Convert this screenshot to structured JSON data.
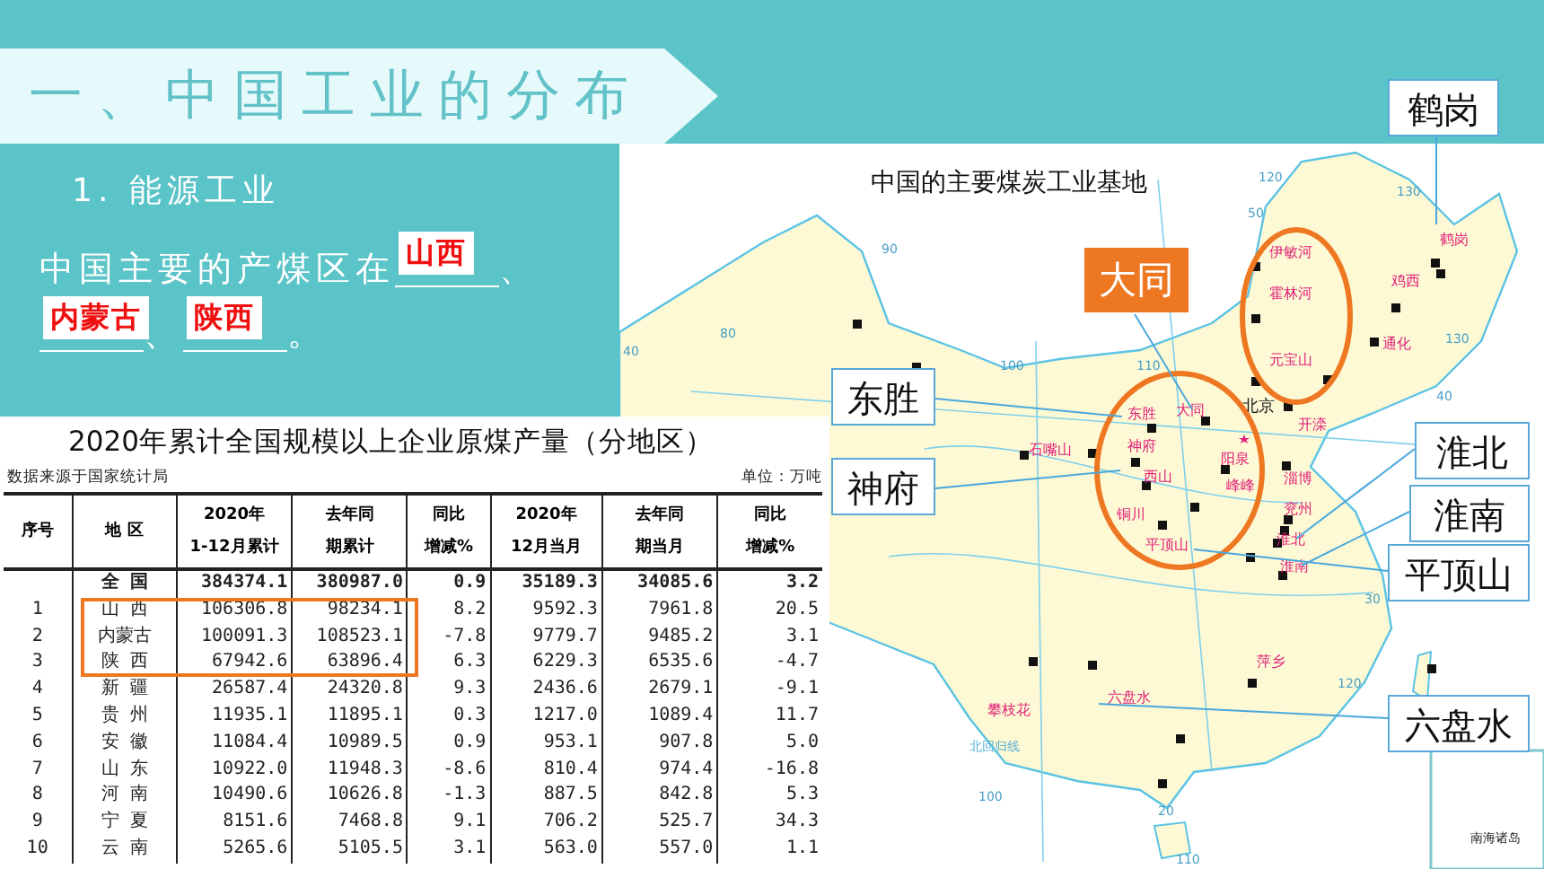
{
  "banner": {
    "title": "一、中国工业的分布"
  },
  "section": {
    "heading": "1. 能源工业",
    "sentence": [
      {
        "kind": "text",
        "text": "中国主要的产煤区在"
      },
      {
        "kind": "blank",
        "answer": "山西"
      },
      {
        "kind": "text",
        "text": "、"
      },
      {
        "kind": "blank",
        "answer": "内蒙古"
      },
      {
        "kind": "text",
        "text": "、"
      },
      {
        "kind": "blank",
        "answer": "陕西"
      },
      {
        "kind": "text",
        "text": "。"
      }
    ]
  },
  "table": {
    "title": "2020年累计全国规模以上企业原煤产量（分地区）",
    "source": "数据来源于国家统计局",
    "unit": "单位：万吨",
    "columns": [
      [
        "序号"
      ],
      [
        "地 区"
      ],
      [
        "2020年",
        "1-12月累计"
      ],
      [
        "去年同",
        "期累计"
      ],
      [
        "同比",
        "增减%"
      ],
      [
        "2020年",
        "12月当月"
      ],
      [
        "去年同",
        "期当月"
      ],
      [
        "同比",
        "增减%"
      ]
    ],
    "rows": [
      {
        "kind": "total",
        "region": "全 国",
        "values": [
          "384374.1",
          "380987.0",
          "0.9",
          "35189.3",
          "34085.6",
          "3.2"
        ],
        "highlighted": false
      },
      {
        "kind": "region",
        "no": "1",
        "region": "山 西",
        "values": [
          "106306.8",
          "98234.1",
          "8.2",
          "9592.3",
          "7961.8",
          "20.5"
        ],
        "highlighted": true
      },
      {
        "kind": "region",
        "no": "2",
        "region": "内蒙古",
        "values": [
          "100091.3",
          "108523.1",
          "-7.8",
          "9779.7",
          "9485.2",
          "3.1"
        ],
        "highlighted": true
      },
      {
        "kind": "region",
        "no": "3",
        "region": "陕 西",
        "values": [
          "67942.6",
          "63896.4",
          "6.3",
          "6229.3",
          "6535.6",
          "-4.7"
        ],
        "highlighted": true
      },
      {
        "kind": "region",
        "no": "4",
        "region": "新 疆",
        "values": [
          "26587.4",
          "24320.8",
          "9.3",
          "2436.6",
          "2679.1",
          "-9.1"
        ],
        "highlighted": false
      },
      {
        "kind": "region",
        "no": "5",
        "region": "贵 州",
        "values": [
          "11935.1",
          "11895.1",
          "0.3",
          "1217.0",
          "1089.4",
          "11.7"
        ],
        "highlighted": false
      },
      {
        "kind": "region",
        "no": "6",
        "region": "安 徽",
        "values": [
          "11084.4",
          "10989.5",
          "0.9",
          "953.1",
          "907.8",
          "5.0"
        ],
        "highlighted": false
      },
      {
        "kind": "region",
        "no": "7",
        "region": "山 东",
        "values": [
          "10922.0",
          "11948.3",
          "-8.6",
          "810.4",
          "974.4",
          "-16.8"
        ],
        "highlighted": false
      },
      {
        "kind": "region",
        "no": "8",
        "region": "河 南",
        "values": [
          "10490.6",
          "10626.8",
          "-1.3",
          "887.5",
          "842.8",
          "5.3"
        ],
        "highlighted": false
      },
      {
        "kind": "region",
        "no": "9",
        "region": "宁 夏",
        "values": [
          "8151.6",
          "7468.8",
          "9.1",
          "706.2",
          "525.7",
          "34.3"
        ],
        "highlighted": false
      },
      {
        "kind": "region",
        "no": "10",
        "region": "云 南",
        "values": [
          "5265.6",
          "5105.5",
          "3.1",
          "563.0",
          "557.0",
          "1.1"
        ],
        "highlighted": false
      }
    ]
  },
  "map": {
    "title": "中国的主要煤炭工业基地",
    "labels": [
      {
        "text": "伊敏河",
        "kind": "city"
      },
      {
        "text": "霍林河",
        "kind": "city"
      },
      {
        "text": "元宝山",
        "kind": "city"
      },
      {
        "text": "鹤岗",
        "kind": "city"
      },
      {
        "text": "鸡西",
        "kind": "city"
      },
      {
        "text": "通化",
        "kind": "city"
      },
      {
        "text": "开滦",
        "kind": "city"
      },
      {
        "text": "北京",
        "kind": "capital"
      },
      {
        "text": "东胜",
        "kind": "city"
      },
      {
        "text": "大同",
        "kind": "city"
      },
      {
        "text": "石嘴山",
        "kind": "city"
      },
      {
        "text": "神府",
        "kind": "city"
      },
      {
        "text": "阳泉",
        "kind": "city"
      },
      {
        "text": "西山",
        "kind": "city"
      },
      {
        "text": "峰峰",
        "kind": "city"
      },
      {
        "text": "淄博",
        "kind": "city"
      },
      {
        "text": "铜川",
        "kind": "city"
      },
      {
        "text": "兖州",
        "kind": "city"
      },
      {
        "text": "淮北",
        "kind": "city"
      },
      {
        "text": "平顶山",
        "kind": "city"
      },
      {
        "text": "淮南",
        "kind": "city"
      },
      {
        "text": "萍乡",
        "kind": "city"
      },
      {
        "text": "攀枝花",
        "kind": "city"
      },
      {
        "text": "六盘水",
        "kind": "city"
      },
      {
        "text": "北回归线",
        "kind": "line"
      },
      {
        "text": "南海诸岛",
        "kind": "inset"
      },
      {
        "text": "120",
        "kind": "degree"
      },
      {
        "text": "130",
        "kind": "degree"
      },
      {
        "text": "50",
        "kind": "degree"
      },
      {
        "text": "90",
        "kind": "degree"
      },
      {
        "text": "80",
        "kind": "degree"
      },
      {
        "text": "40",
        "kind": "degree"
      },
      {
        "text": "100",
        "kind": "degree"
      },
      {
        "text": "110",
        "kind": "degree"
      },
      {
        "text": "130",
        "kind": "degree"
      },
      {
        "text": "40",
        "kind": "degree"
      },
      {
        "text": "30",
        "kind": "degree"
      },
      {
        "text": "120",
        "kind": "degree"
      },
      {
        "text": "100",
        "kind": "degree"
      },
      {
        "text": "20",
        "kind": "degree"
      },
      {
        "text": "110",
        "kind": "degree"
      }
    ],
    "callouts": [
      {
        "text": "鹤岗",
        "kind": "plain"
      },
      {
        "text": "大同",
        "kind": "orange"
      },
      {
        "text": "东胜",
        "kind": "plain"
      },
      {
        "text": "神府",
        "kind": "plain"
      },
      {
        "text": "淮北",
        "kind": "plain"
      },
      {
        "text": "淮南",
        "kind": "plain"
      },
      {
        "text": "平顶山",
        "kind": "plain"
      },
      {
        "text": "六盘水",
        "kind": "plain"
      }
    ]
  }
}
